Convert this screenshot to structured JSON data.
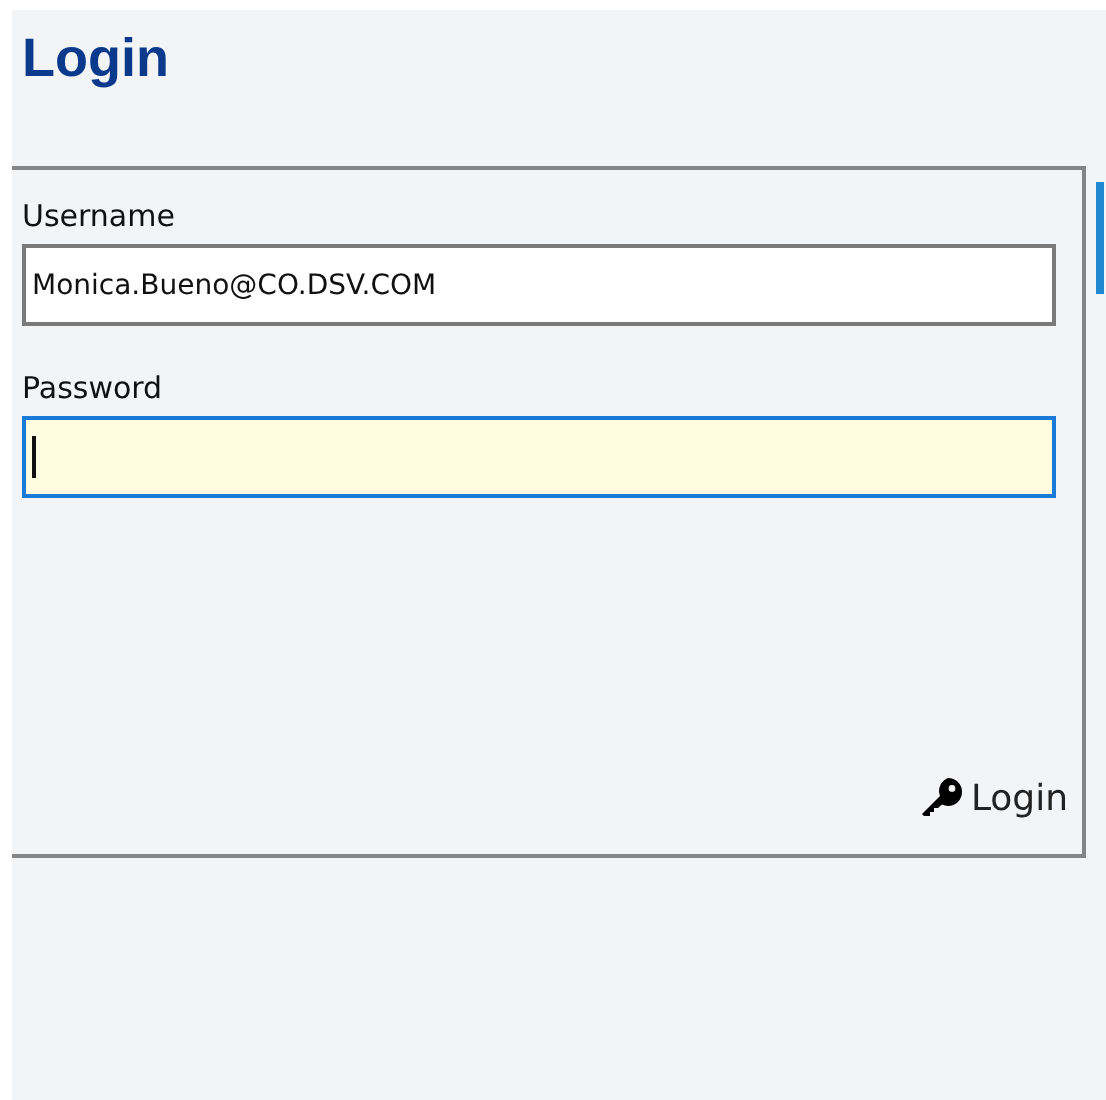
{
  "title": "Login",
  "fields": [
    {
      "label": "Username",
      "value": "Monica.Bueno@CO.DSV.COM",
      "focused": false
    },
    {
      "label": "Password",
      "focused": true
    }
  ],
  "button": {
    "label": "Login"
  }
}
